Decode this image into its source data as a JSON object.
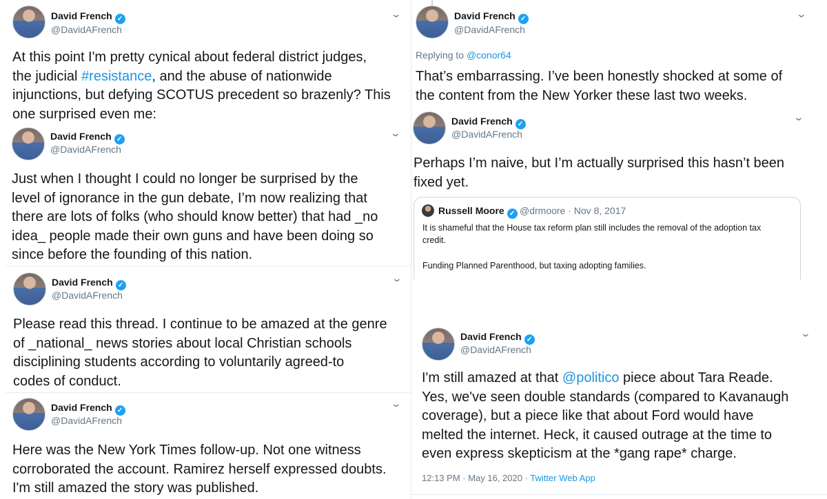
{
  "author": {
    "name": "David French",
    "handle": "@DavidAFrench"
  },
  "colors": {
    "link": "#1b95e0",
    "verified": "#1da1f2",
    "muted": "#657786"
  },
  "icons": {
    "verified": "verified-badge-icon",
    "menu": "chevron-down-icon"
  },
  "tweets": [
    {
      "lines": [
        "At this point I'm pretty cynical about federal district judges,",
        ", and the abuse of nationwide",
        "injunctions, but defying SCOTUS precedent so brazenly? This",
        "one surprised even me:"
      ],
      "line2_prefix": "the judicial ",
      "hashtag": "#resistance"
    },
    {
      "lines": [
        "Just when I thought I could no longer be surprised by the",
        "level of ignorance in the gun debate, I’m now realizing that",
        "there are lots of folks (who should know better) that had _no",
        "idea_ people made their own guns and have been doing so",
        "since before the founding of this nation."
      ]
    },
    {
      "lines": [
        "Please read this thread. I continue to be amazed at the genre",
        "of _national_ news stories about local Christian schools",
        "disciplining students according to voluntarily agreed-to",
        "codes of conduct."
      ]
    },
    {
      "lines": [
        "Here was the New York Times follow-up. Not one witness",
        "corroborated the account. Ramirez herself expressed doubts.",
        "I'm still amazed the story was published."
      ]
    },
    {
      "reply_prefix": "Replying to ",
      "reply_to": "@conor64",
      "lines": [
        "That’s embarrassing. I’ve been honestly shocked at some of",
        "the content from the New Yorker these last two weeks."
      ]
    },
    {
      "lines": [
        "Perhaps I’m naive, but I’m actually surprised this hasn’t been",
        "fixed yet."
      ],
      "quote": {
        "name": "Russell Moore",
        "handle": "@drmoore",
        "date": "· Nov 8, 2017",
        "lines": [
          "It is shameful that the House tax reform plan still includes the removal of the adoption tax",
          "credit.",
          "Funding Planned Parenthood, but taxing adopting families."
        ]
      }
    },
    {
      "line1_prefix": "I'm still amazed at that ",
      "mention": "@politico",
      "line1_suffix": " piece about Tara Reade.",
      "lines": [
        "Yes, we've seen double standards (compared to Kavanaugh",
        "coverage), but a piece like that about Ford would have",
        "melted the internet. Heck, it caused outrage at the time to",
        "even express skepticism at the *gang rape* charge."
      ],
      "timestamp": "12:13 PM · May 16, 2020 · ",
      "source": "Twitter Web App"
    }
  ]
}
